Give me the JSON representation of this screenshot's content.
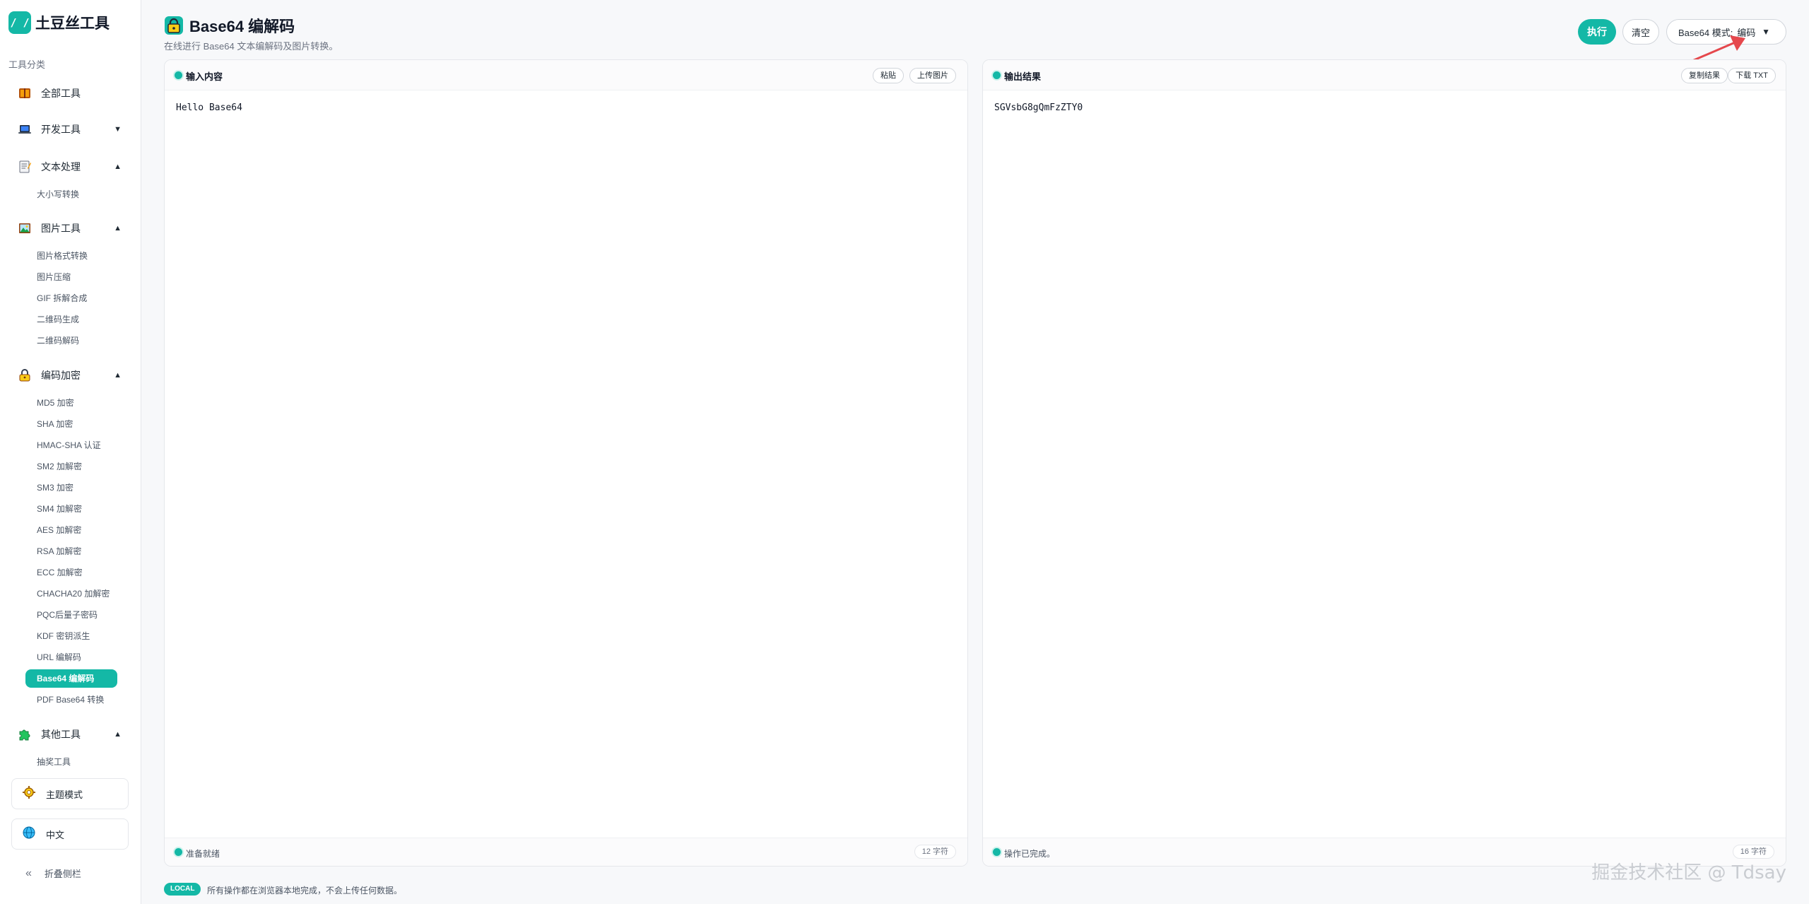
{
  "brand": {
    "name": "土豆丝工具",
    "logo_text": "/ /"
  },
  "sidebar": {
    "section_title": "工具分类",
    "categories": [
      {
        "label": "全部工具",
        "icon": "book-icon",
        "caret": ""
      },
      {
        "label": "开发工具",
        "icon": "laptop-icon",
        "caret": "▼"
      },
      {
        "label": "文本处理",
        "icon": "memo-icon",
        "caret": "▲"
      },
      {
        "label": "图片工具",
        "icon": "picture-icon",
        "caret": "▲"
      },
      {
        "label": "编码加密",
        "icon": "lock-icon",
        "caret": "▲"
      },
      {
        "label": "其他工具",
        "icon": "puzzle-icon",
        "caret": "▲"
      }
    ],
    "text_items": [
      "大小写转换"
    ],
    "image_items": [
      "图片格式转换",
      "图片压缩",
      "GIF 拆解合成",
      "二维码生成",
      "二维码解码"
    ],
    "crypto_items": [
      "MD5 加密",
      "SHA 加密",
      "HMAC-SHA 认证",
      "SM2 加解密",
      "SM3 加密",
      "SM4 加解密",
      "AES 加解密",
      "RSA 加解密",
      "ECC 加解密",
      "CHACHA20 加解密",
      "PQC后量子密码",
      "KDF 密钥派生",
      "URL 编解码",
      "Base64 编解码",
      "PDF Base64 转换"
    ],
    "other_items": [
      "抽奖工具"
    ],
    "theme_label": "主题模式",
    "lang_label": "中文",
    "collapse_icon": "«",
    "collapse_label": "折叠侧栏"
  },
  "header": {
    "title": "Base64 编解码",
    "subtitle": "在线进行 Base64 文本编解码及图片转换。",
    "run_label": "执行",
    "clear_label": "清空",
    "mode_label": "Base64 模式:",
    "mode_value": "编码"
  },
  "input_panel": {
    "title": "输入内容",
    "paste_label": "粘贴",
    "upload_label": "上传图片",
    "value": "Hello Base64",
    "status": "准备就绪",
    "count": "12 字符"
  },
  "output_panel": {
    "title": "输出结果",
    "copy_label": "复制结果",
    "download_label": "下载 TXT",
    "value": "SGVsbG8gQmFzZTY0",
    "status": "操作已完成。",
    "count": "16 字符"
  },
  "footer": {
    "badge": "LOCAL",
    "note": "所有操作都在浏览器本地完成，不会上传任何数据。"
  },
  "watermark": "掘金技术社区 @ Tdsay",
  "colors": {
    "accent": "#14b8a6",
    "annotation": "#e5484d"
  }
}
